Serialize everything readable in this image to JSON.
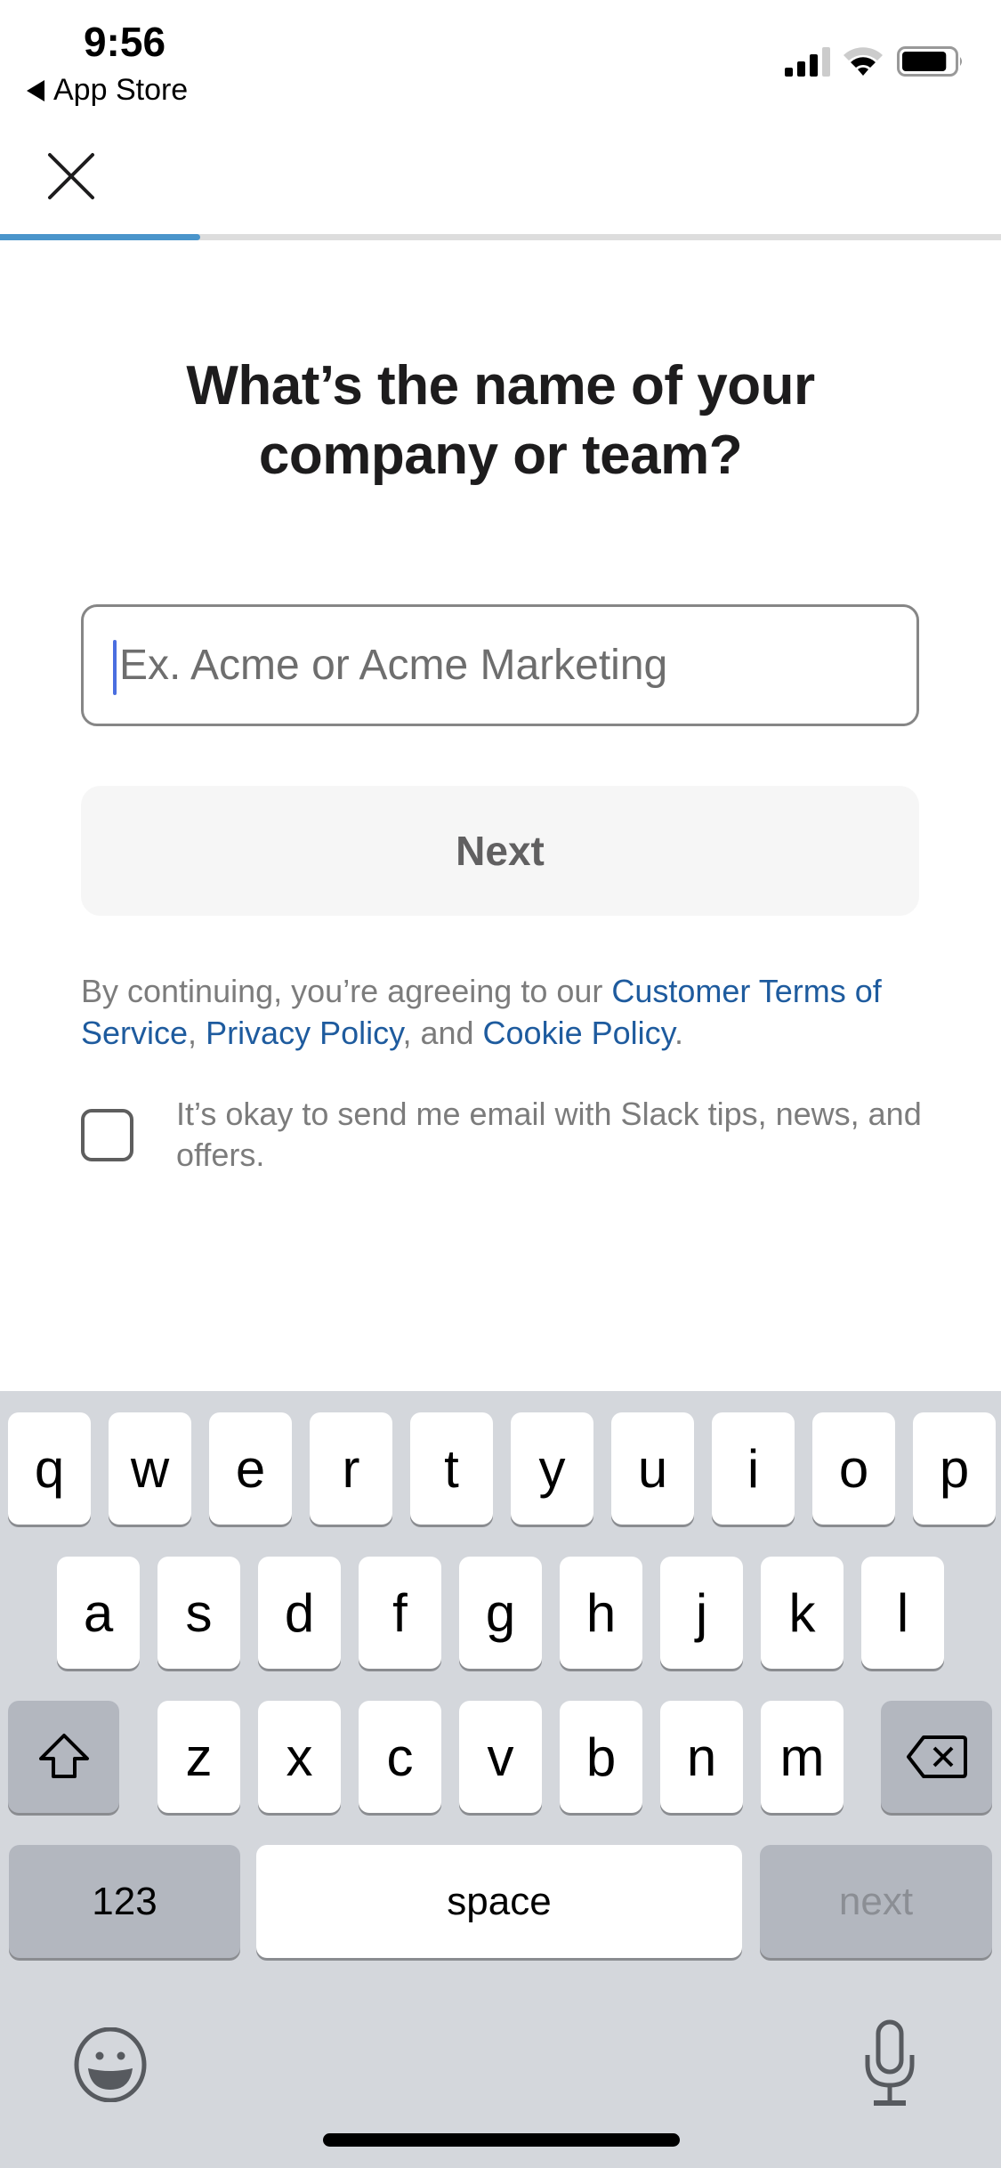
{
  "status_bar": {
    "time": "9:56",
    "back_label": "App Store",
    "signal_bars": 3,
    "signal_bars_total": 4,
    "wifi_level": 2,
    "wifi_level_total": 3,
    "battery_level": 0.85
  },
  "header": {
    "close_icon": "close-icon",
    "progress_fraction": 0.2,
    "progress_color": "#4a95cb"
  },
  "main": {
    "title": "What’s the name of your company or team?",
    "name_input": {
      "value": "",
      "placeholder": "Ex. Acme or Acme Marketing"
    },
    "next_button": "Next",
    "legal": {
      "prefix": "By continuing, you’re agreeing to our ",
      "link_terms": "Customer Terms of Service",
      "sep1": ", ",
      "link_privacy": "Privacy Policy",
      "sep2": ", and ",
      "link_cookie": "Cookie Policy",
      "suffix": "."
    },
    "email_opt_in": {
      "checked": false,
      "label": "It’s okay to send me email with Slack tips, news, and offers."
    },
    "link_color": "#1e5b9e"
  },
  "keyboard": {
    "row1": [
      "q",
      "w",
      "e",
      "r",
      "t",
      "y",
      "u",
      "i",
      "o",
      "p"
    ],
    "row2": [
      "a",
      "s",
      "d",
      "f",
      "g",
      "h",
      "j",
      "k",
      "l"
    ],
    "row3": [
      "z",
      "x",
      "c",
      "v",
      "b",
      "n",
      "m"
    ],
    "shift_icon": "shift-icon",
    "delete_icon": "delete-icon",
    "numbers_label": "123",
    "space_label": "space",
    "return_label": "next",
    "emoji_icon": "emoji-icon",
    "mic_icon": "microphone-icon"
  }
}
